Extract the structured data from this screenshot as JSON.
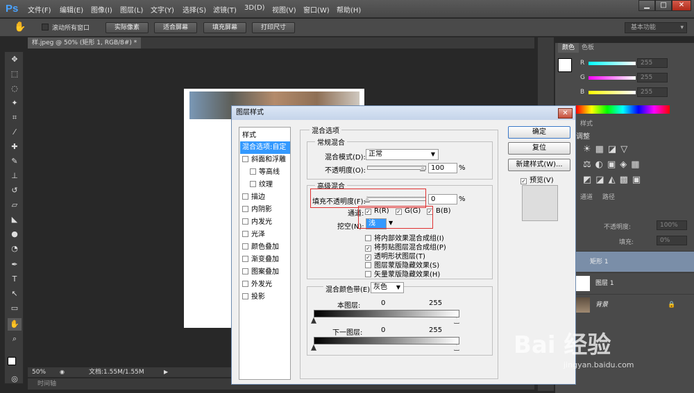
{
  "app": {
    "logo": "Ps"
  },
  "menu": [
    "文件(F)",
    "编辑(E)",
    "图像(I)",
    "图层(L)",
    "文字(Y)",
    "选择(S)",
    "滤镜(T)",
    "3D(D)",
    "视图(V)",
    "窗口(W)",
    "帮助(H)"
  ],
  "window_buttons": {
    "minimize": "▁",
    "restore": "□",
    "close": "✕"
  },
  "options": {
    "scroll_all": "滚动所有窗口",
    "actual_pixels": "实际像素",
    "fit_screen": "适合屏幕",
    "fill_screen": "填充屏幕",
    "print_size": "打印尺寸",
    "workspace": "基本功能"
  },
  "document_tab": "样.jpeg @ 50% (矩形 1, RGB/8#) *",
  "status": {
    "zoom": "50%",
    "doc_size": "文档:1.55M/1.55M"
  },
  "timeline_label": "时间轴",
  "panels": {
    "color_tab": "颜色",
    "swatches_tab": "色板",
    "r_label": "R",
    "g_label": "G",
    "b_label": "B",
    "r_value": "255",
    "g_value": "255",
    "b_value": "255",
    "style_tab": "样式",
    "adjust_label": "调整",
    "channels_tab": "通道",
    "paths_tab": "路径",
    "opacity_label": "不透明度:",
    "opacity_value": "100%",
    "fill_label": "填充:",
    "fill_value": "0%",
    "layers": [
      {
        "name": "矩形 1"
      },
      {
        "name": "图层 1"
      },
      {
        "name": "背景"
      }
    ]
  },
  "dialog": {
    "title": "图层样式",
    "styles_header": "样式",
    "style_items": [
      "混合选项:自定",
      "斜面和浮雕",
      "等高线",
      "纹理",
      "描边",
      "内阴影",
      "内发光",
      "光泽",
      "颜色叠加",
      "渐变叠加",
      "图案叠加",
      "外发光",
      "投影"
    ],
    "blend_options_title": "混合选项",
    "general_blend_title": "常规混合",
    "blend_mode_label": "混合模式(D):",
    "blend_mode_value": "正常",
    "opacity_label": "不透明度(O):",
    "opacity_value": "100",
    "percent": "%",
    "advanced_blend_title": "高级混合",
    "fill_opacity_label": "填充不透明度(F):",
    "fill_opacity_value": "0",
    "channels_label": "通道:",
    "channel_r": "R(R)",
    "channel_g": "G(G)",
    "channel_b": "B(B)",
    "knockout_label": "挖空(N):",
    "knockout_value": "浅",
    "opt1": "将内部效果混合成组(I)",
    "opt2": "将剪贴图层混合成组(P)",
    "opt3": "透明形状图层(T)",
    "opt4": "图层蒙版隐藏效果(S)",
    "opt5": "矢量蒙版隐藏效果(H)",
    "blend_if_label": "混合颜色带(E):",
    "blend_if_value": "灰色",
    "this_layer": "本图层:",
    "underlying_layer": "下一图层:",
    "v0": "0",
    "v255": "255",
    "v0b": "0",
    "v255b": "255",
    "ok": "确定",
    "reset": "复位",
    "new_style": "新建样式(W)...",
    "preview": "预览(V)",
    "close_glyph": "✕"
  },
  "watermark": {
    "text": "Bai 经验",
    "url": "jingyan.baidu.com"
  }
}
